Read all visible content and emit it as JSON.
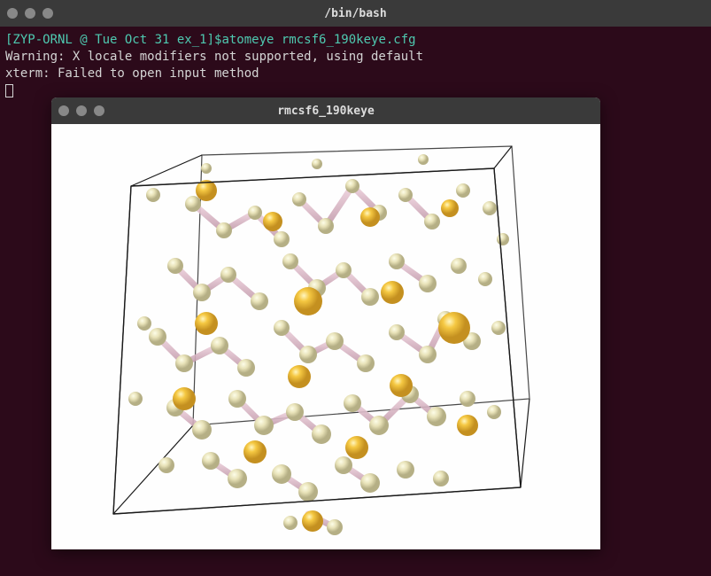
{
  "terminal": {
    "title": "/bin/bash",
    "prompt": "[ZYP-ORNL @ Tue Oct 31 ex_1]$",
    "command": "atomeye rmcsf6_190keye.cfg",
    "lines": [
      "Warning: X locale modifiers not supported, using default",
      "xterm: Failed to open input method"
    ]
  },
  "viewer": {
    "title": "rmcsf6_190keye",
    "atom_colors": {
      "large": "#f5c842",
      "small": "#e8e2b8",
      "bond": "#d9b8c5"
    }
  }
}
